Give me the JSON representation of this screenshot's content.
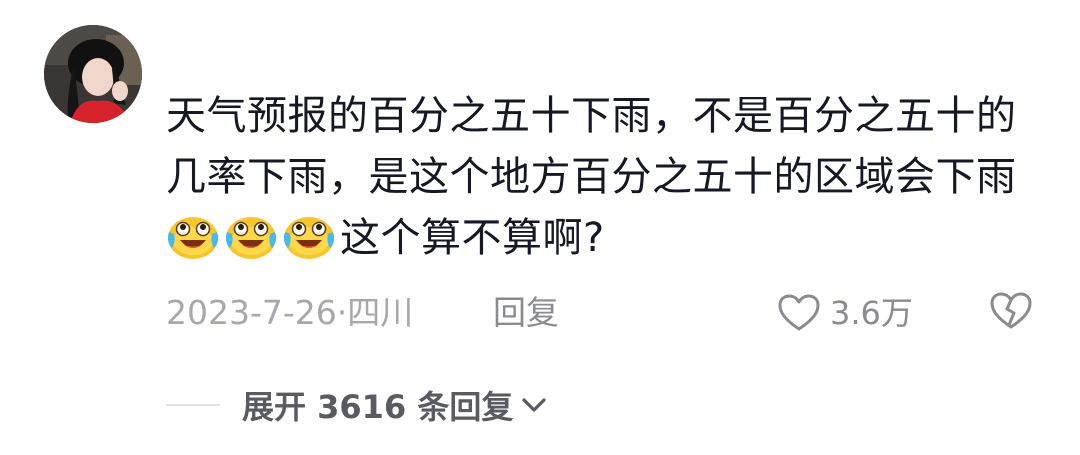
{
  "comment": {
    "avatar_icon": "user-avatar",
    "text_part1": "天气预报的百分之五十下雨，不是百分之五十的几率下雨，是这个地方百分之五十的区域会下雨",
    "emojis": [
      "crying-laughing-emoji",
      "crying-laughing-emoji",
      "crying-laughing-emoji"
    ],
    "text_part2": "这个算不算啊?",
    "date_location": "2023-7-26·四川",
    "reply_label": "回复",
    "like_count": "3.6万",
    "like_icon": "heart-outline-icon",
    "dislike_icon": "broken-heart-icon"
  },
  "replies": {
    "expand_label": "展开 3616 条回复",
    "expand_icon": "chevron-down-icon"
  }
}
